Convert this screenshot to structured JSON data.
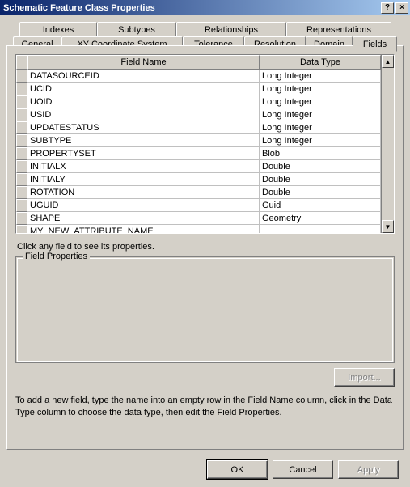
{
  "window": {
    "title": "Schematic Feature Class Properties",
    "help_btn": "?",
    "close_btn": "×"
  },
  "tabs": {
    "row1": [
      {
        "label": "Indexes"
      },
      {
        "label": "Subtypes"
      },
      {
        "label": "Relationships"
      },
      {
        "label": "Representations"
      }
    ],
    "row2": [
      {
        "label": "General"
      },
      {
        "label": "XY Coordinate System"
      },
      {
        "label": "Tolerance"
      },
      {
        "label": "Resolution"
      },
      {
        "label": "Domain"
      },
      {
        "label": "Fields",
        "selected": true
      }
    ]
  },
  "grid": {
    "col_name": "Field Name",
    "col_type": "Data Type",
    "rows": [
      {
        "name": "DATASOURCEID",
        "type": "Long Integer"
      },
      {
        "name": "UCID",
        "type": "Long Integer"
      },
      {
        "name": "UOID",
        "type": "Long Integer"
      },
      {
        "name": "USID",
        "type": "Long Integer"
      },
      {
        "name": "UPDATESTATUS",
        "type": "Long Integer"
      },
      {
        "name": "SUBTYPE",
        "type": "Long Integer"
      },
      {
        "name": "PROPERTYSET",
        "type": "Blob"
      },
      {
        "name": "INITIALX",
        "type": "Double"
      },
      {
        "name": "INITIALY",
        "type": "Double"
      },
      {
        "name": "ROTATION",
        "type": "Double"
      },
      {
        "name": "UGUID",
        "type": "Guid"
      },
      {
        "name": "SHAPE",
        "type": "Geometry"
      },
      {
        "name": "MY_NEW_ATTRIBUTE_NAME",
        "type": "",
        "editing": true
      }
    ]
  },
  "labels": {
    "click_hint": "Click any field to see its properties.",
    "group_title": "Field Properties",
    "import_btn": "Import...",
    "help_para": "To add a new field, type the name into an empty row in the Field Name column, click in the Data Type column to choose the data type, then edit the Field Properties.",
    "ok": "OK",
    "cancel": "Cancel",
    "apply": "Apply"
  }
}
